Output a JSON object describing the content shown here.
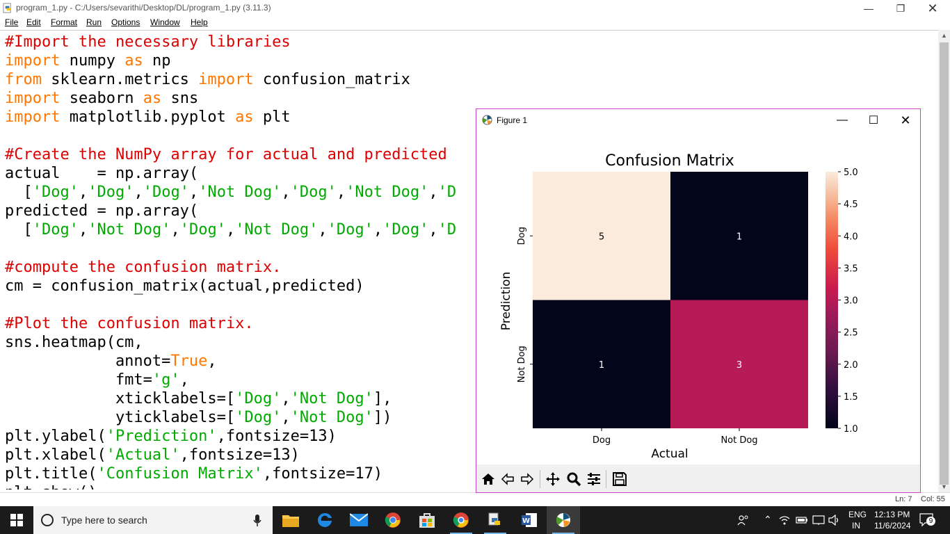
{
  "idle": {
    "title": "program_1.py - C:/Users/sevarithi/Desktop/DL/program_1.py (3.11.3)",
    "menu": [
      "File",
      "Edit",
      "Format",
      "Run",
      "Options",
      "Window",
      "Help"
    ],
    "status": {
      "line": "Ln: 7",
      "col": "Col: 55"
    }
  },
  "code_lines": [
    [
      [
        "#Import the necessary libraries",
        "comment"
      ]
    ],
    [
      [
        "import",
        "kw"
      ],
      [
        " numpy ",
        "plain"
      ],
      [
        "as",
        "kw"
      ],
      [
        " np",
        "plain"
      ]
    ],
    [
      [
        "from",
        "kw"
      ],
      [
        " sklearn.metrics ",
        "plain"
      ],
      [
        "import",
        "kw"
      ],
      [
        " confusion_matrix",
        "plain"
      ]
    ],
    [
      [
        "import",
        "kw"
      ],
      [
        " seaborn ",
        "plain"
      ],
      [
        "as",
        "kw"
      ],
      [
        " sns",
        "plain"
      ]
    ],
    [
      [
        "import",
        "kw"
      ],
      [
        " matplotlib.pyplot ",
        "plain"
      ],
      [
        "as",
        "kw"
      ],
      [
        " plt",
        "plain"
      ]
    ],
    [],
    [
      [
        "#Create the NumPy array for actual and predicted",
        "comment"
      ]
    ],
    [
      [
        "actual    = np.array(",
        "plain"
      ]
    ],
    [
      [
        "  [",
        "plain"
      ],
      [
        "'Dog'",
        "str"
      ],
      [
        ",",
        "plain"
      ],
      [
        "'Dog'",
        "str"
      ],
      [
        ",",
        "plain"
      ],
      [
        "'Dog'",
        "str"
      ],
      [
        ",",
        "plain"
      ],
      [
        "'Not Dog'",
        "str"
      ],
      [
        ",",
        "plain"
      ],
      [
        "'Dog'",
        "str"
      ],
      [
        ",",
        "plain"
      ],
      [
        "'Not Dog'",
        "str"
      ],
      [
        ",",
        "plain"
      ],
      [
        "'D",
        "str"
      ]
    ],
    [
      [
        "predicted = np.array(",
        "plain"
      ]
    ],
    [
      [
        "  [",
        "plain"
      ],
      [
        "'Dog'",
        "str"
      ],
      [
        ",",
        "plain"
      ],
      [
        "'Not Dog'",
        "str"
      ],
      [
        ",",
        "plain"
      ],
      [
        "'Dog'",
        "str"
      ],
      [
        ",",
        "plain"
      ],
      [
        "'Not Dog'",
        "str"
      ],
      [
        ",",
        "plain"
      ],
      [
        "'Dog'",
        "str"
      ],
      [
        ",",
        "plain"
      ],
      [
        "'Dog'",
        "str"
      ],
      [
        ",",
        "plain"
      ],
      [
        "'D",
        "str"
      ]
    ],
    [],
    [
      [
        "#compute the confusion matrix.",
        "comment"
      ]
    ],
    [
      [
        "cm = confusion_matrix(actual,predicted)",
        "plain"
      ]
    ],
    [],
    [
      [
        "#Plot the confusion matrix.",
        "comment"
      ]
    ],
    [
      [
        "sns.heatmap(cm,",
        "plain"
      ]
    ],
    [
      [
        "            annot=",
        "plain"
      ],
      [
        "True",
        "kw"
      ],
      [
        ",",
        "plain"
      ]
    ],
    [
      [
        "            fmt=",
        "plain"
      ],
      [
        "'g'",
        "str"
      ],
      [
        ",",
        "plain"
      ]
    ],
    [
      [
        "            xticklabels=[",
        "plain"
      ],
      [
        "'Dog'",
        "str"
      ],
      [
        ",",
        "plain"
      ],
      [
        "'Not Dog'",
        "str"
      ],
      [
        "],",
        "plain"
      ]
    ],
    [
      [
        "            yticklabels=[",
        "plain"
      ],
      [
        "'Dog'",
        "str"
      ],
      [
        ",",
        "plain"
      ],
      [
        "'Not Dog'",
        "str"
      ],
      [
        "])",
        "plain"
      ]
    ],
    [
      [
        "plt.ylabel(",
        "plain"
      ],
      [
        "'Prediction'",
        "str"
      ],
      [
        ",fontsize=13)",
        "plain"
      ]
    ],
    [
      [
        "plt.xlabel(",
        "plain"
      ],
      [
        "'Actual'",
        "str"
      ],
      [
        ",fontsize=13)",
        "plain"
      ]
    ],
    [
      [
        "plt.title(",
        "plain"
      ],
      [
        "'Confusion Matrix'",
        "str"
      ],
      [
        ",fontsize=17)",
        "plain"
      ]
    ],
    [
      [
        "plt.show()",
        "plain"
      ]
    ]
  ],
  "figure": {
    "window_title": "Figure 1"
  },
  "chart_data": {
    "type": "heatmap",
    "title": "Confusion Matrix",
    "xlabel": "Actual",
    "ylabel": "Prediction",
    "x_categories": [
      "Dog",
      "Not Dog"
    ],
    "y_categories": [
      "Dog",
      "Not Dog"
    ],
    "values": [
      [
        5,
        1
      ],
      [
        1,
        3
      ]
    ],
    "annotations": [
      "5",
      "1",
      "1",
      "3"
    ],
    "colorbar": {
      "min": 1.0,
      "max": 5.0,
      "ticks": [
        "1.0",
        "1.5",
        "2.0",
        "2.5",
        "3.0",
        "3.5",
        "4.0",
        "4.5",
        "5.0"
      ]
    },
    "colormap": "rocket",
    "colors": {
      "low": "#03051a",
      "mid": "#cb1b4f",
      "high": "#faebdd"
    }
  },
  "taskbar": {
    "search_placeholder": "Type here to search",
    "language": [
      "ENG",
      "IN"
    ],
    "time": "12:13 PM",
    "date": "11/6/2024",
    "notifications": "9"
  }
}
